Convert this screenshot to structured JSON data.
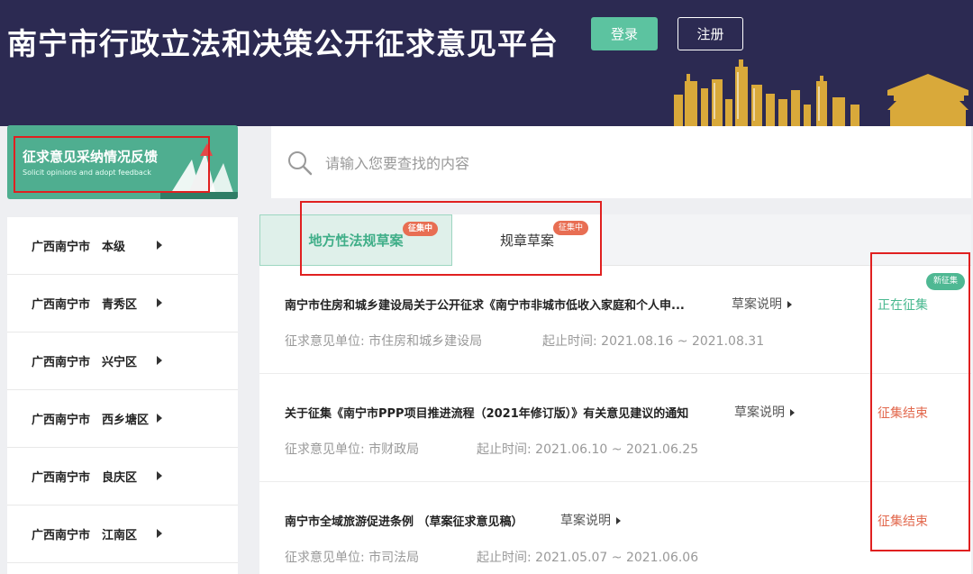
{
  "header": {
    "site_title": "南宁市行政立法和决策公开征求意见平台",
    "login_label": "登录",
    "register_label": "注册"
  },
  "feedback_banner": {
    "title": "征求意见采纳情况反馈",
    "subtitle": "Solicit opinions and adopt feedback"
  },
  "search": {
    "placeholder": "请输入您要查找的内容"
  },
  "sidebar": {
    "items": [
      {
        "city": "广西南宁市",
        "district": "本级"
      },
      {
        "city": "广西南宁市",
        "district": "青秀区"
      },
      {
        "city": "广西南宁市",
        "district": "兴宁区"
      },
      {
        "city": "广西南宁市",
        "district": "西乡塘区"
      },
      {
        "city": "广西南宁市",
        "district": "良庆区"
      },
      {
        "city": "广西南宁市",
        "district": "江南区"
      }
    ]
  },
  "tabs": [
    {
      "label": "地方性法规草案",
      "badge": "征集中"
    },
    {
      "label": "规章草案",
      "badge": "征集中"
    }
  ],
  "list": [
    {
      "title": "南宁市住房和城乡建设局关于公开征求《南宁市非城市低收入家庭和个人申...",
      "explain": "草案说明",
      "unit_label": "征求意见单位:",
      "unit": "市住房和城乡建设局",
      "time_label": "起止时间:",
      "time": "2021.08.16 ~ 2021.08.31",
      "status": "正在征集",
      "badge": "新征集"
    },
    {
      "title": "关于征集《南宁市PPP项目推进流程（2021年修订版）》有关意见建议的通知",
      "explain": "草案说明",
      "unit_label": "征求意见单位:",
      "unit": "市财政局",
      "time_label": "起止时间:",
      "time": "2021.06.10 ~ 2021.06.25",
      "status": "征集结束"
    },
    {
      "title": "南宁市全域旅游促进条例 （草案征求意见稿）",
      "explain": "草案说明",
      "unit_label": "征求意见单位:",
      "unit": "市司法局",
      "time_label": "起止时间:",
      "time": "2021.05.07 ~ 2021.06.06",
      "status": "征集结束"
    }
  ],
  "colors": {
    "header_bg": "#2c2a52",
    "accent_green": "#5cc3a0",
    "status_closed": "#e2684d",
    "annotation_red": "#e02020"
  }
}
